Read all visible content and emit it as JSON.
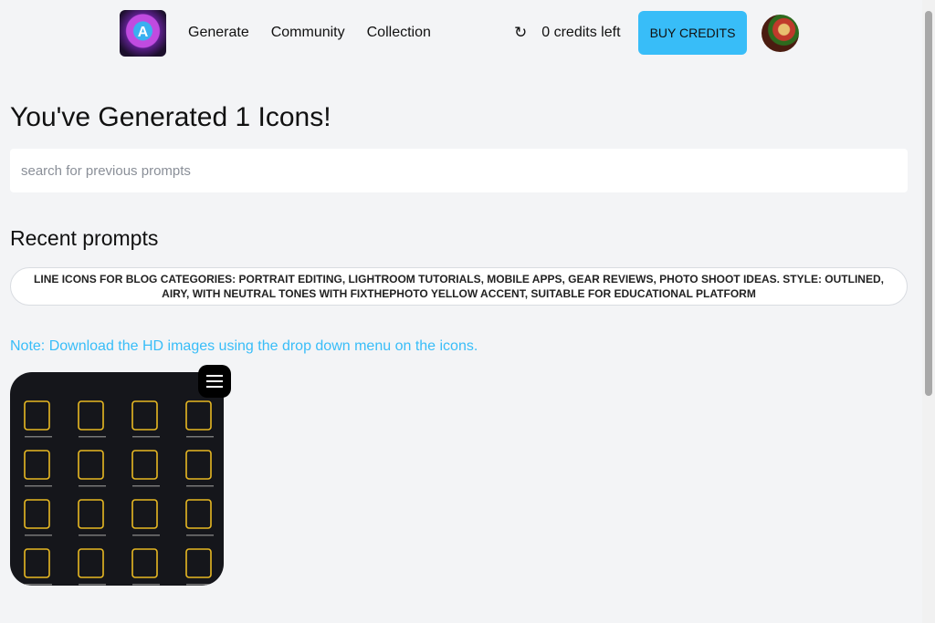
{
  "nav": {
    "logo_letter": "A",
    "links": [
      "Generate",
      "Community",
      "Collection"
    ],
    "credits": "0 credits left",
    "buy_label": "BUY CREDITS"
  },
  "main": {
    "title": "You've Generated 1 Icons!",
    "search_placeholder": "search for previous prompts",
    "recent_heading": "Recent prompts",
    "prompts": [
      "LINE ICONS FOR BLOG CATEGORIES: PORTRAIT EDITING, LIGHTROOM TUTORIALS, MOBILE APPS, GEAR REVIEWS, PHOTO SHOOT IDEAS. STYLE: OUTLINED, AIRY, WITH NEUTRAL TONES WITH FIXTHEPHOTO YELLOW ACCENT, SUITABLE FOR EDUCATIONAL PLATFORM"
    ],
    "note": "Note: Download the HD images using the drop down menu on the icons."
  },
  "colors": {
    "accent": "#38bdf8",
    "icon_gold": "#e8b923",
    "card_bg": "#15161b"
  }
}
